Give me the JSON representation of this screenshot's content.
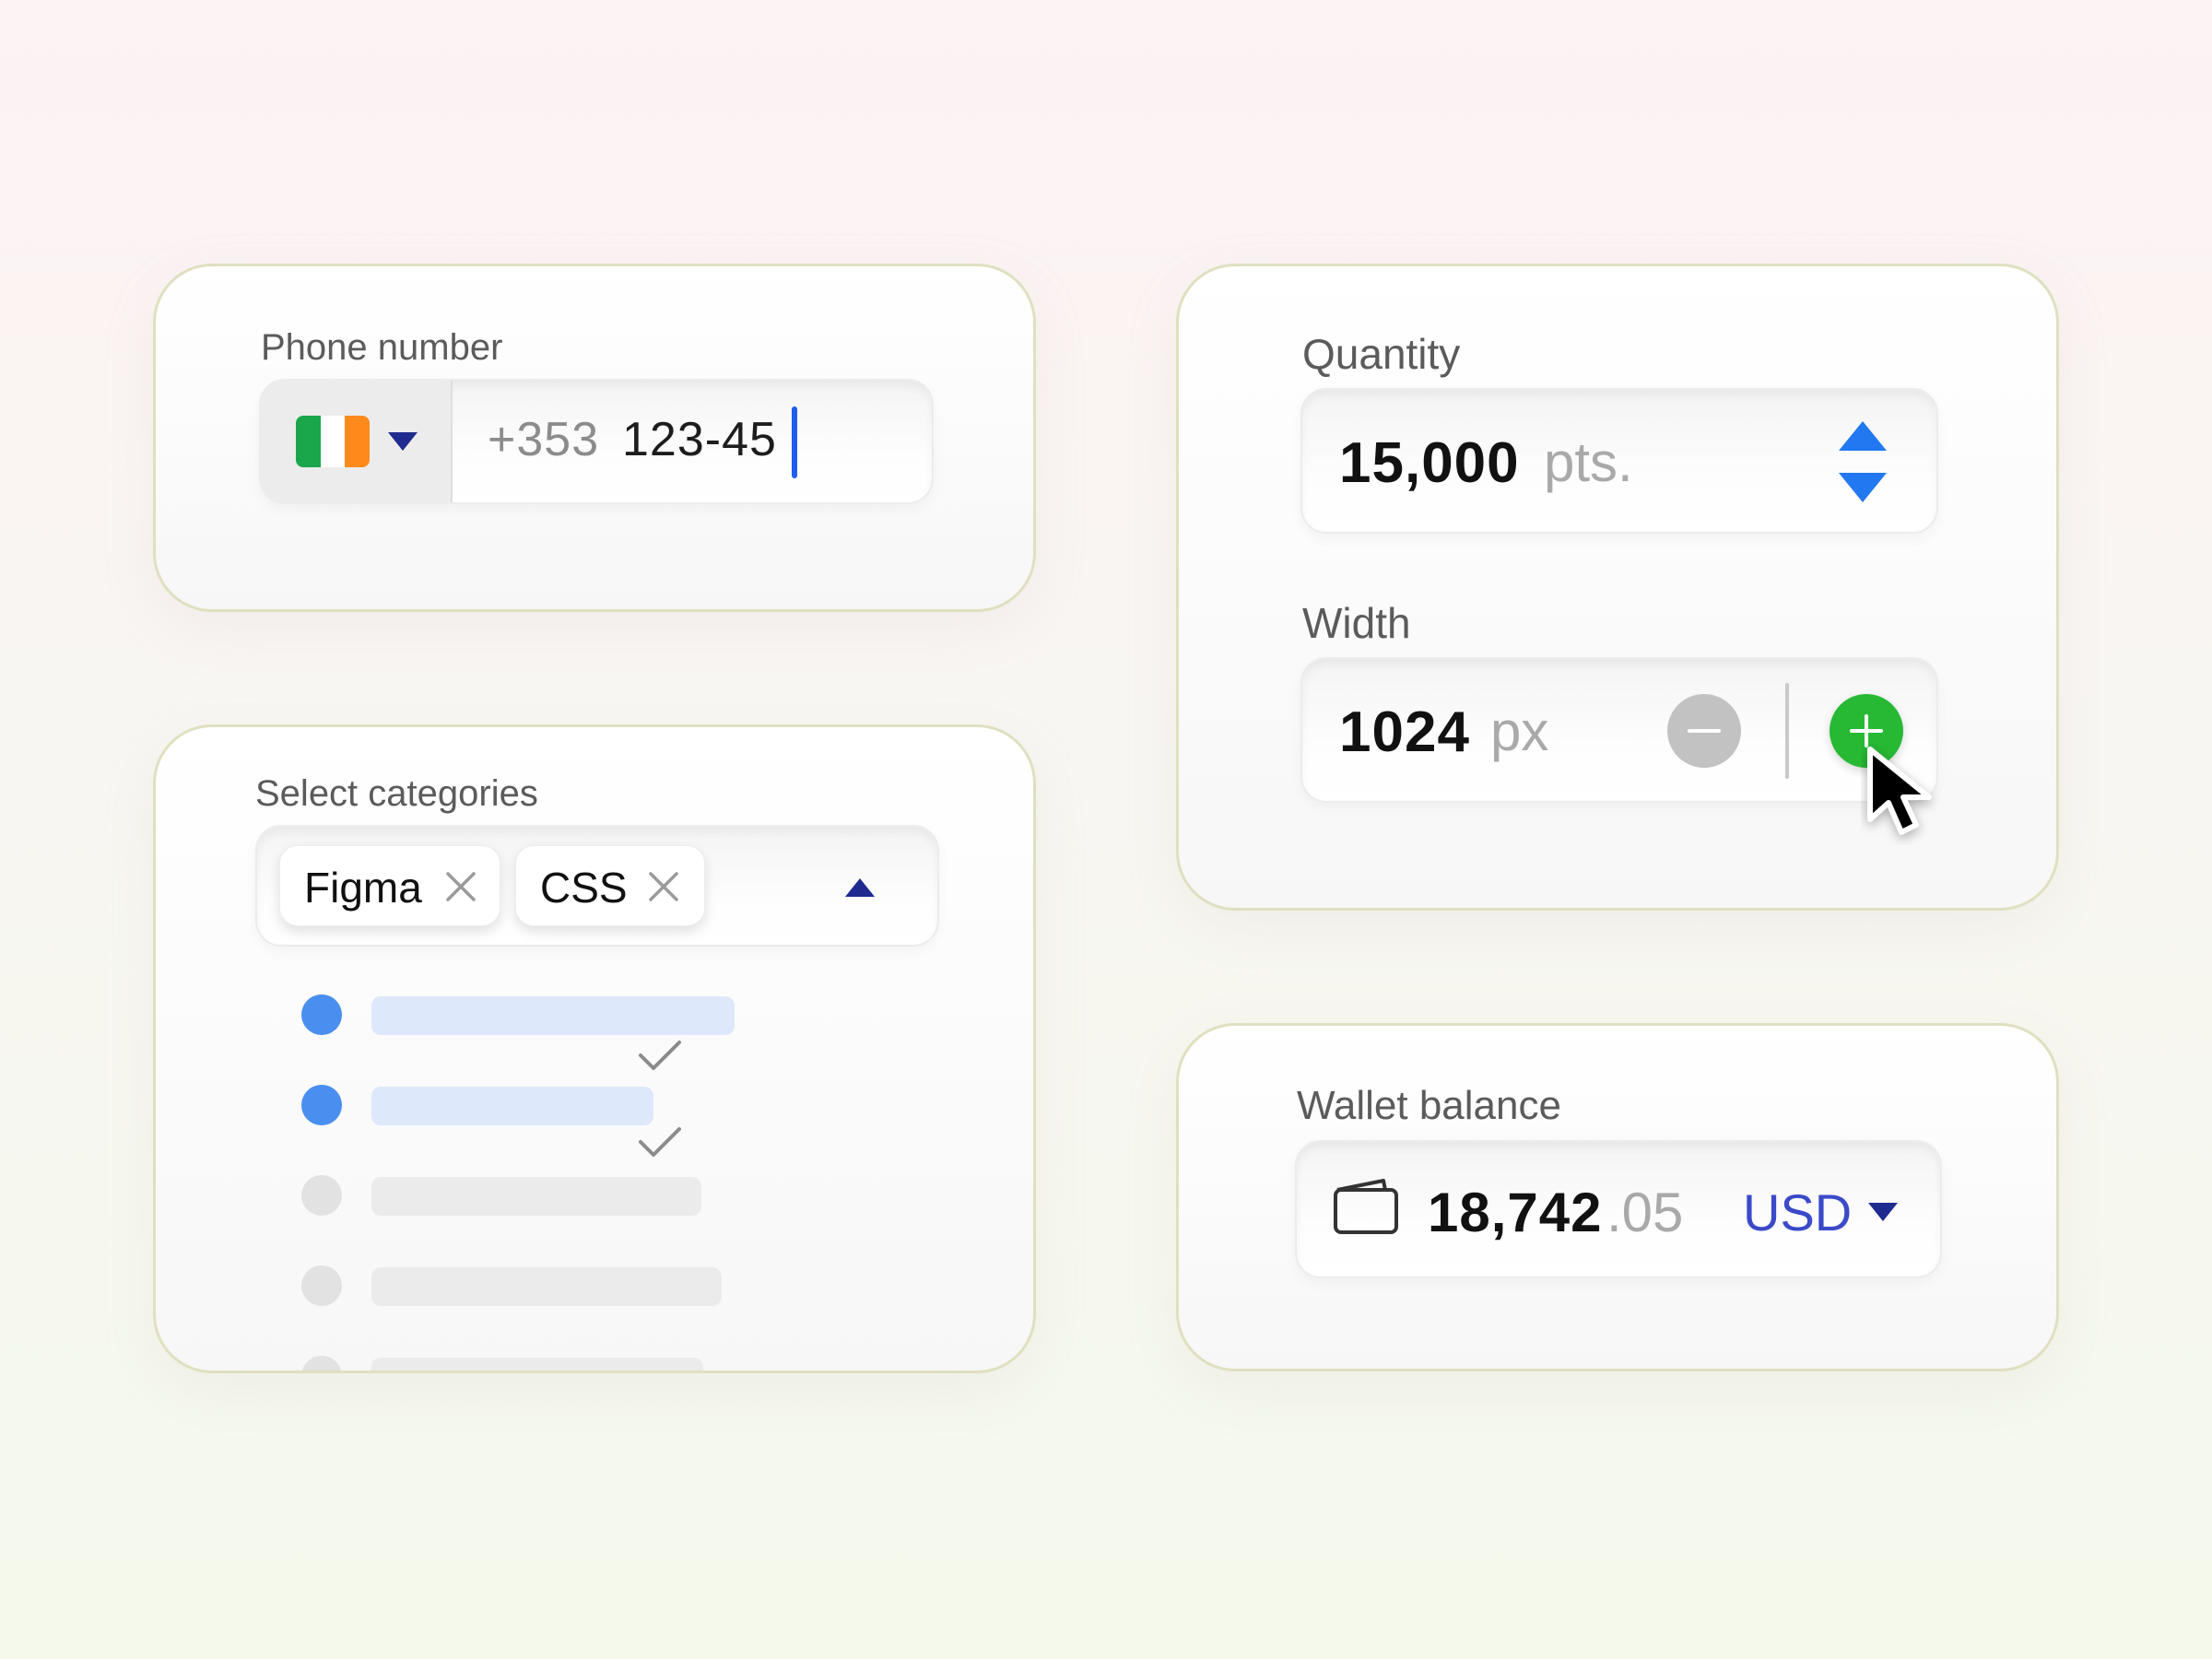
{
  "phone": {
    "label": "Phone number",
    "prefix": "+353",
    "number": "123-45",
    "flag_colors": [
      "#1aa64b",
      "#ffffff",
      "#ff8a1c"
    ]
  },
  "categories": {
    "label": "Select categories",
    "chips": [
      {
        "label": "Figma"
      },
      {
        "label": "CSS"
      }
    ],
    "options": [
      {
        "selected": true
      },
      {
        "selected": true
      },
      {
        "selected": false
      },
      {
        "selected": false
      },
      {
        "selected": false
      }
    ]
  },
  "quantity": {
    "label": "Quantity",
    "value": "15,000",
    "unit": "pts."
  },
  "width": {
    "label": "Width",
    "value": "1024",
    "unit": "px"
  },
  "wallet": {
    "label": "Wallet balance",
    "amount_int": "18,742",
    "amount_dec": ".05",
    "currency": "USD"
  },
  "colors": {
    "accent_blue": "#2278f0",
    "success_green": "#27b934",
    "currency_indigo": "#3b4ac8",
    "card_border": "#dfe0c0"
  }
}
